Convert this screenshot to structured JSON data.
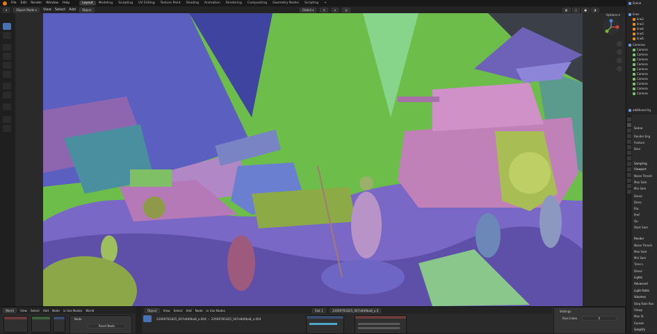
{
  "topbar": {
    "menus": [
      "File",
      "Edit",
      "Render",
      "Window",
      "Help"
    ],
    "workspaces": [
      {
        "label": "Layout",
        "active": true
      },
      {
        "label": "Modeling",
        "active": false
      },
      {
        "label": "Sculpting",
        "active": false
      },
      {
        "label": "UV Editing",
        "active": false
      },
      {
        "label": "Texture Paint",
        "active": false
      },
      {
        "label": "Shading",
        "active": false
      },
      {
        "label": "Animation",
        "active": false
      },
      {
        "label": "Rendering",
        "active": false
      },
      {
        "label": "Compositing",
        "active": false
      },
      {
        "label": "Geometry Nodes",
        "active": false
      },
      {
        "label": "Scripting",
        "active": false
      }
    ],
    "add_workspace": "+",
    "scene_name": "Scene"
  },
  "viewport_header": {
    "mode": "Object Mode",
    "menus": [
      "View",
      "Select",
      "Add",
      "Object"
    ],
    "transform_orientation": "Global",
    "options_label": "Options"
  },
  "outliner": {
    "items": [
      {
        "label": "lines",
        "type": "collection"
      },
      {
        "label": "line2",
        "type": "object"
      },
      {
        "label": "line3",
        "type": "object"
      },
      {
        "label": "line4",
        "type": "object"
      },
      {
        "label": "line5",
        "type": "object"
      },
      {
        "label": "line6",
        "type": "object"
      },
      {
        "label": "Cameras",
        "type": "collection"
      },
      {
        "label": "Camera",
        "type": "camera"
      },
      {
        "label": "Camera",
        "type": "camera"
      },
      {
        "label": "Camera",
        "type": "camera"
      },
      {
        "label": "Camera",
        "type": "camera"
      },
      {
        "label": "Camera",
        "type": "camera"
      },
      {
        "label": "Camera",
        "type": "camera"
      },
      {
        "label": "Camera",
        "type": "camera"
      },
      {
        "label": "Camera",
        "type": "camera"
      },
      {
        "label": "Camera",
        "type": "camera"
      },
      {
        "label": "Camera",
        "type": "camera"
      },
      {
        "label": "additional lig",
        "type": "collection"
      }
    ]
  },
  "properties": {
    "scene_label": "Scene",
    "rows": [
      {
        "label": "Render Eng",
        "kind": "field"
      },
      {
        "label": "Feature",
        "kind": "field"
      },
      {
        "label": "Devi",
        "kind": "field"
      },
      {
        "label": "Sampling",
        "kind": "section"
      },
      {
        "label": "Viewport",
        "kind": "subsection"
      },
      {
        "label": "Noise Thresh",
        "kind": "field"
      },
      {
        "label": "Max Sam",
        "kind": "field"
      },
      {
        "label": "Min Sam",
        "kind": "field"
      },
      {
        "label": "Denoi",
        "kind": "check"
      },
      {
        "label": "Deno",
        "kind": "field"
      },
      {
        "label": "Pas",
        "kind": "field"
      },
      {
        "label": "Pref",
        "kind": "field"
      },
      {
        "label": "Qu",
        "kind": "field"
      },
      {
        "label": "Start Sam",
        "kind": "field"
      },
      {
        "label": "Render",
        "kind": "subsection"
      },
      {
        "label": "Noise Thresh",
        "kind": "field"
      },
      {
        "label": "Max Sam",
        "kind": "field"
      },
      {
        "label": "Min Sam",
        "kind": "field"
      },
      {
        "label": "Time L",
        "kind": "field"
      },
      {
        "label": "Denoi",
        "kind": "check"
      },
      {
        "label": "Lights",
        "kind": "subsection"
      },
      {
        "label": "Advanced",
        "kind": "subsection"
      },
      {
        "label": "Light Paths",
        "kind": "section"
      },
      {
        "label": "Volumes",
        "kind": "section"
      },
      {
        "label": "Step Rate Ren",
        "kind": "field"
      },
      {
        "label": "Viewp",
        "kind": "field"
      },
      {
        "label": "Max St",
        "kind": "field"
      },
      {
        "label": "Curves",
        "kind": "section"
      },
      {
        "label": "Simplify",
        "kind": "section"
      }
    ]
  },
  "bottom": {
    "left_editor": {
      "world": "World",
      "menus": [
        "View",
        "Select",
        "Add",
        "Node"
      ],
      "use_nodes": "Use Nodes",
      "world_name": "World"
    },
    "mid_editor": {
      "type": "Object",
      "menus": [
        "View",
        "Select",
        "Add",
        "Node"
      ],
      "use_nodes": "Use Nodes",
      "slot": "Slot 1",
      "material": "22609781825_007e8d9ba8_o.0"
    },
    "node_panel": {
      "title": "Node",
      "reset": "Reset Node"
    },
    "breadcrumb": [
      "22609781825_007e8d9ba8_o.004",
      "22609781825_007e8d9ba8_o.004"
    ],
    "settings_panel": {
      "title": "Settings",
      "pass_index_label": "Pass Index",
      "pass_index_value": "0"
    }
  },
  "colors": {
    "accent": "#4772b3",
    "orange": "#e87d0d",
    "green_bg": "#6bbb47",
    "purple": "#8e66b0",
    "blue_shape": "#5b5fbf"
  }
}
